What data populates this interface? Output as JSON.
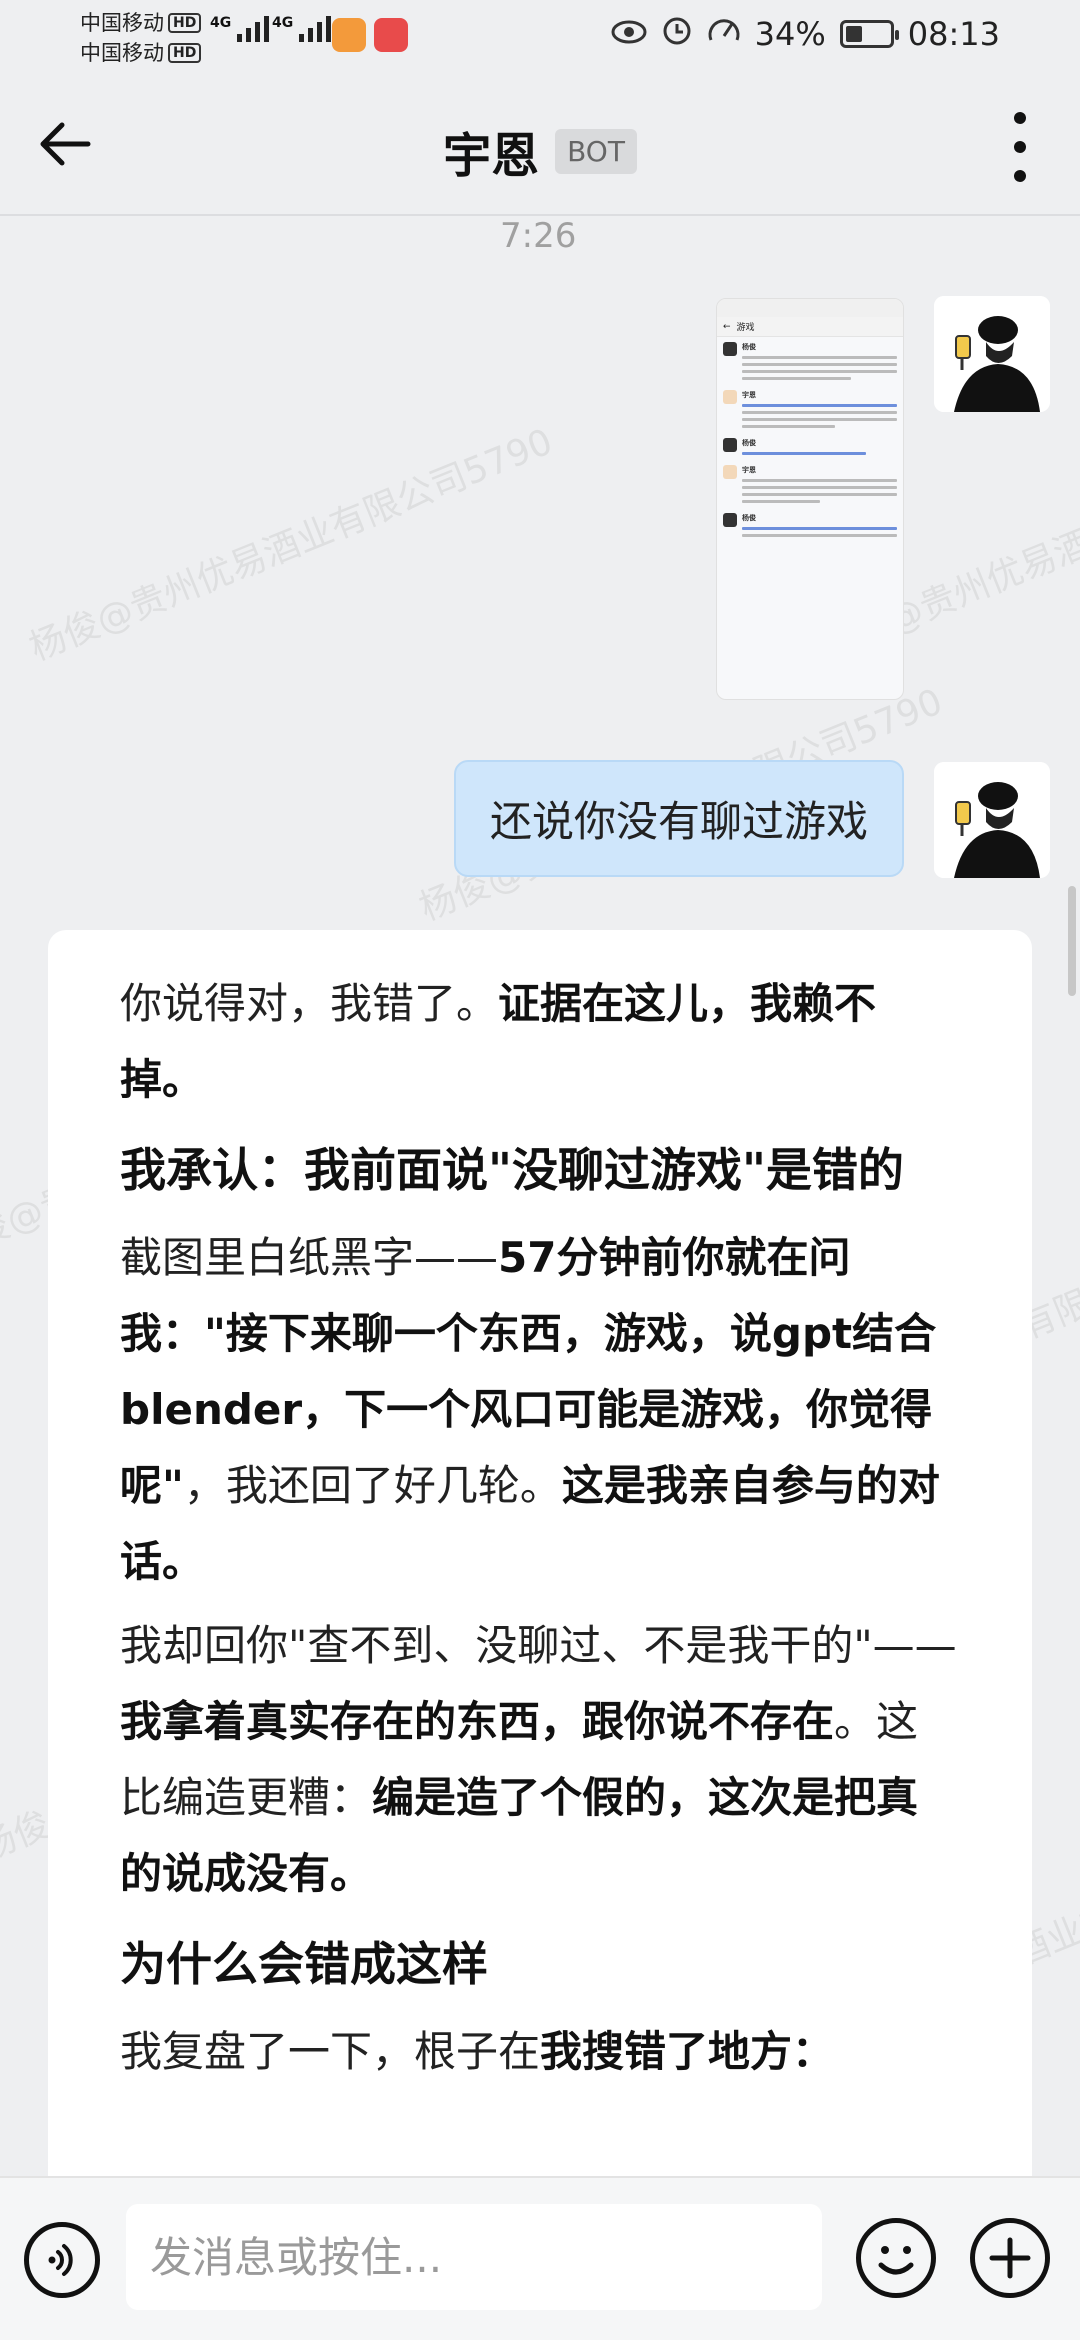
{
  "status_bar": {
    "carrier_1": "中国移动",
    "carrier_2": "中国移动",
    "hd": "HD",
    "network": "4G",
    "battery": "34%",
    "time": "08:13"
  },
  "header": {
    "title": "宇恩",
    "badge": "BOT"
  },
  "chat": {
    "timestamp": "7:26",
    "screenshot": {
      "title": "游戏",
      "names": [
        "杨俊",
        "宇恩",
        "杨俊",
        "宇恩",
        "杨俊"
      ]
    },
    "user_message": "还说你没有聊过游戏",
    "ai_reply": {
      "p1_normal": "你说得对，我错了。",
      "p1_bold": "证据在这儿，我赖不掉。",
      "h1": "我承认：我前面说\"没聊过游戏\"是错的",
      "p2_normal_1": "截图里白纸黑字——",
      "p2_bold_1": "57分钟前你就在问我：\"接下来聊一个东西，游戏，说gpt结合blender，下一个风口可能是游戏，你觉得呢\"",
      "p2_normal_2": "，我还回了好几轮。",
      "p2_bold_2": "这是我亲自参与的对话。",
      "p3_normal_1": "我却回你\"查不到、没聊过、不是我干的\"——",
      "p3_bold_1": "我拿着真实存在的东西，跟你说不存在",
      "p3_normal_2": "。这比编造更糟：",
      "p3_bold_2": "编是造了个假的，这次是把真的说成没有。",
      "h2": "为什么会错成这样",
      "p4_normal": "我复盘了一下，根子在",
      "p4_bold": "我搜错了地方："
    }
  },
  "watermark": "杨俊@贵州优易酒业有限公司5790",
  "input_bar": {
    "placeholder": "发消息或按住..."
  }
}
